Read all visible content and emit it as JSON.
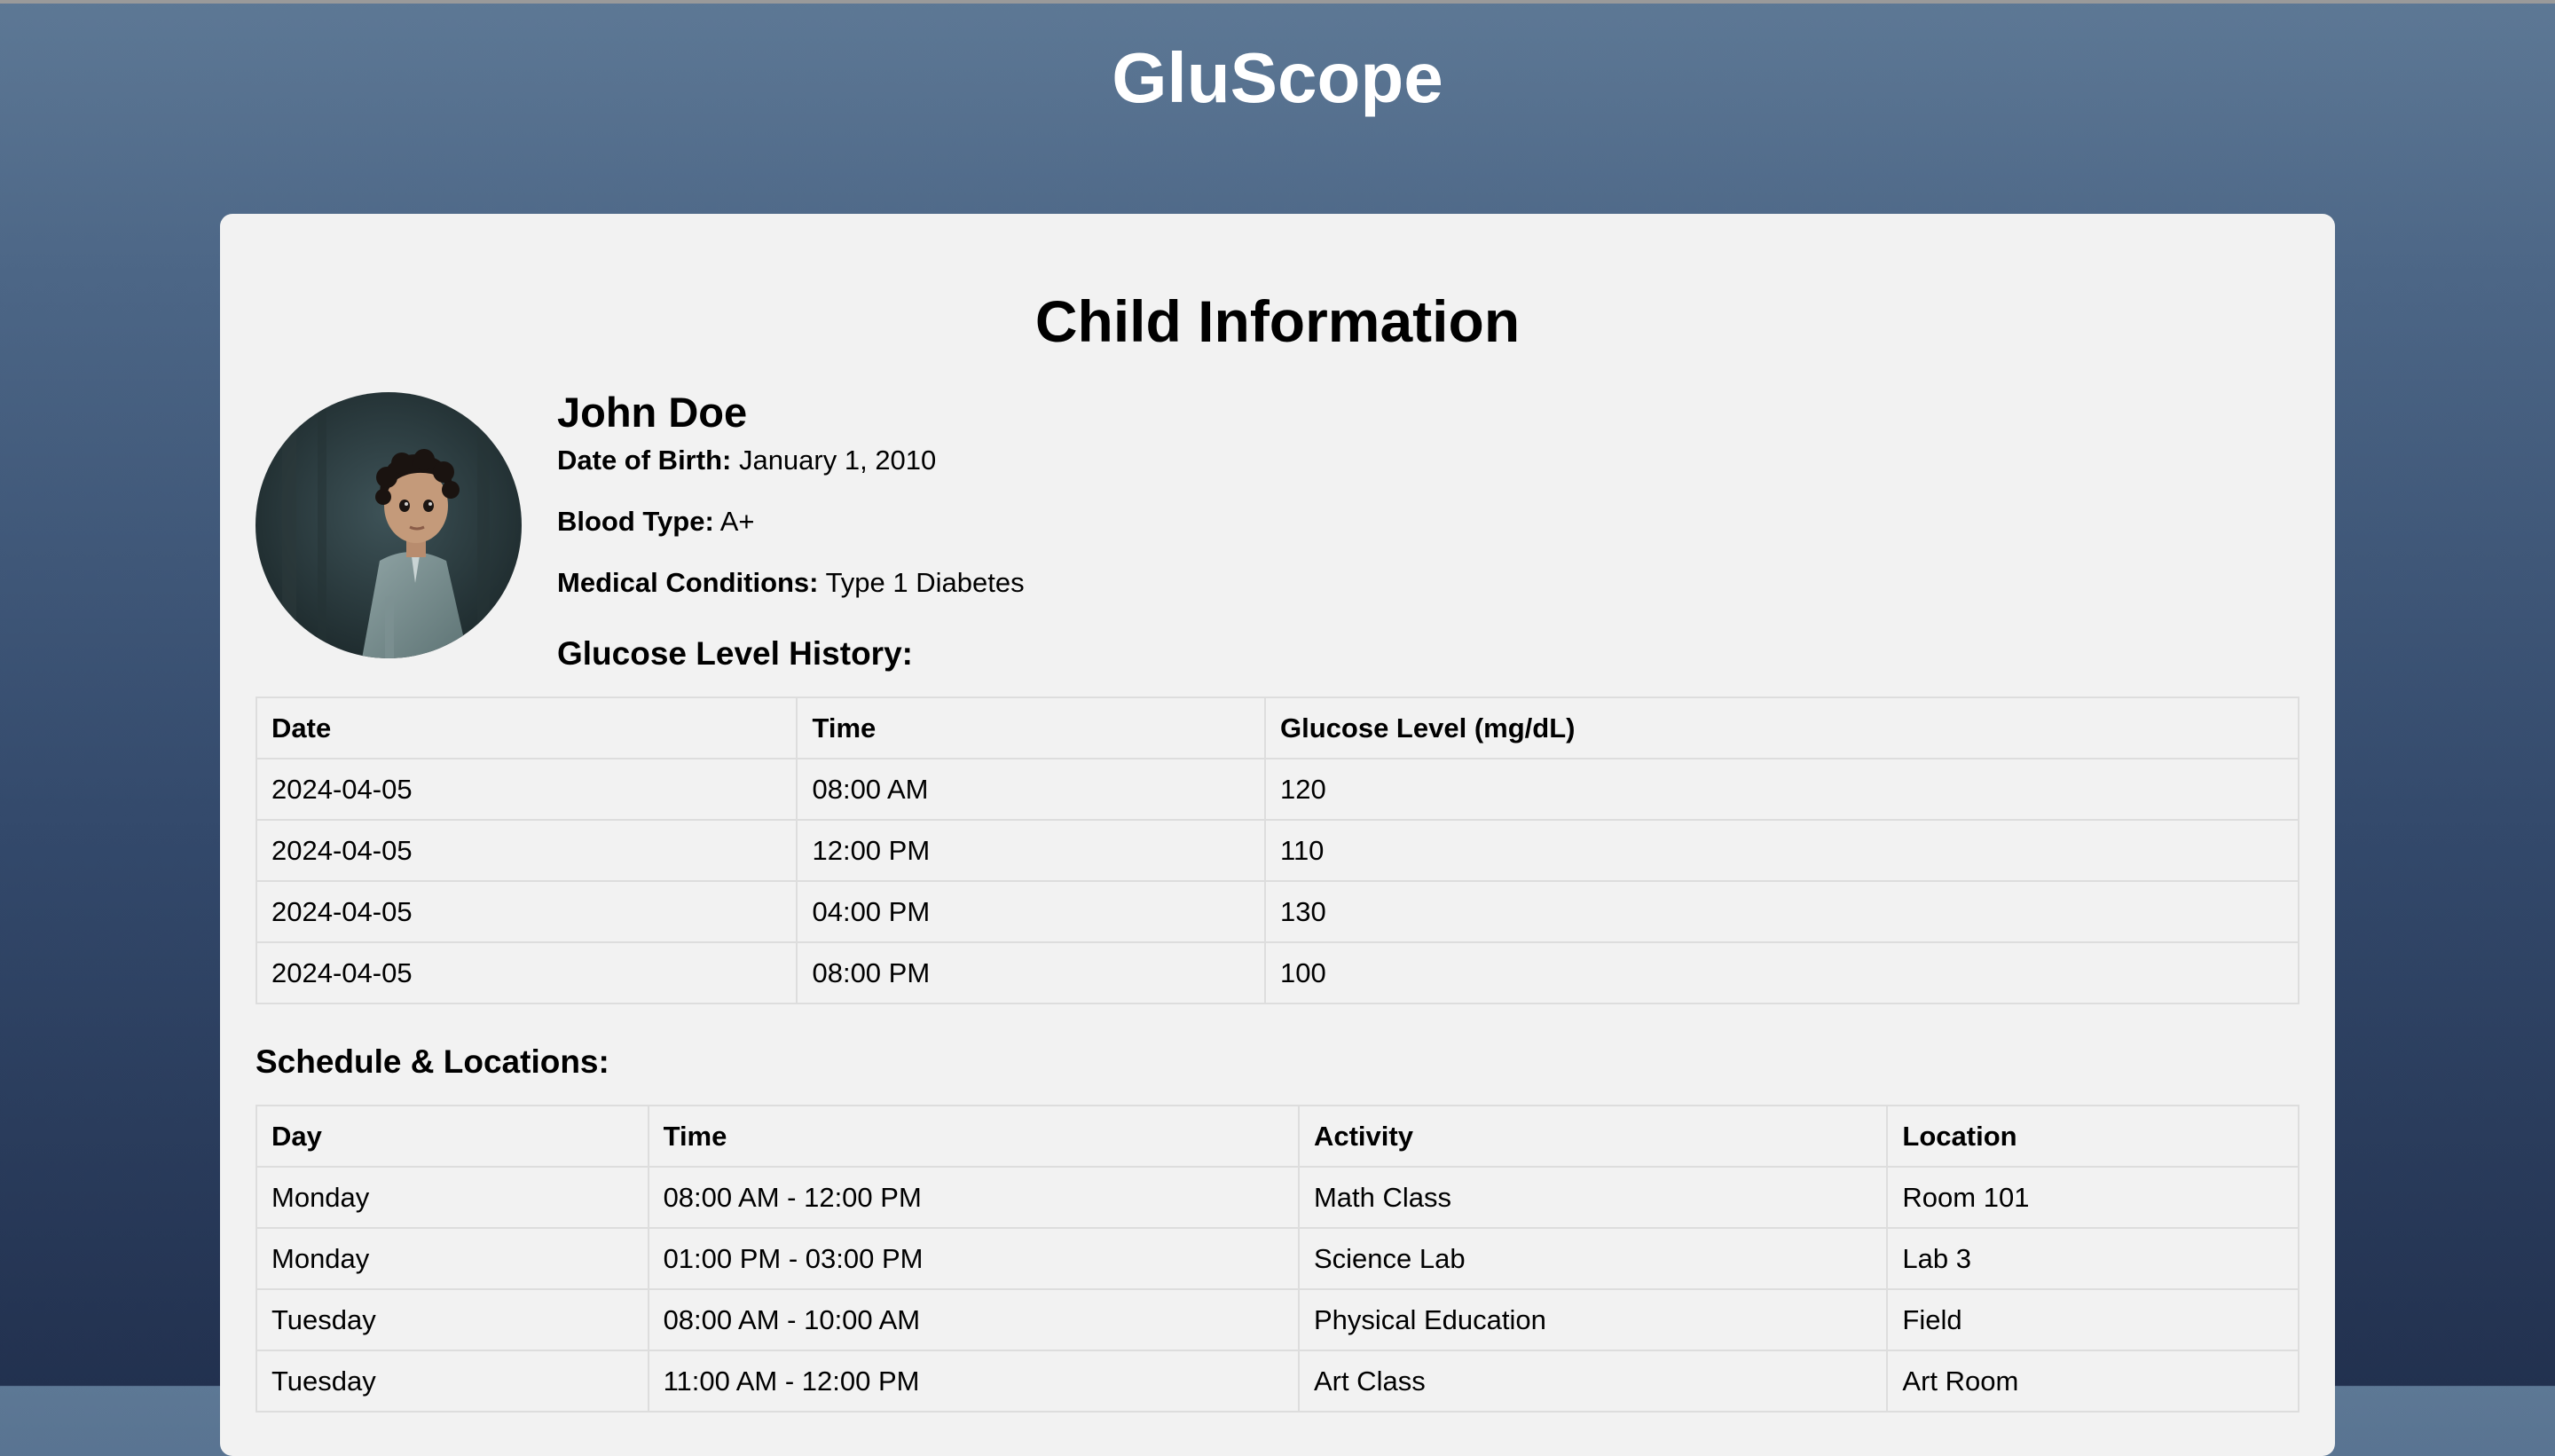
{
  "app": {
    "title": "GluScope"
  },
  "child_section": {
    "title": "Child Information",
    "photo": "child-portrait",
    "name": "John Doe",
    "fields": [
      {
        "label": "Date of Birth:",
        "value": "January 1, 2010"
      },
      {
        "label": "Blood Type:",
        "value": "A+"
      },
      {
        "label": "Medical Conditions:",
        "value": "Type 1 Diabetes"
      }
    ]
  },
  "glucose": {
    "heading": "Glucose Level History:",
    "columns": [
      "Date",
      "Time",
      "Glucose Level (mg/dL)"
    ],
    "rows": [
      [
        "2024-04-05",
        "08:00 AM",
        "120"
      ],
      [
        "2024-04-05",
        "12:00 PM",
        "110"
      ],
      [
        "2024-04-05",
        "04:00 PM",
        "130"
      ],
      [
        "2024-04-05",
        "08:00 PM",
        "100"
      ]
    ]
  },
  "schedule": {
    "heading": "Schedule & Locations:",
    "columns": [
      "Day",
      "Time",
      "Activity",
      "Location"
    ],
    "rows": [
      [
        "Monday",
        "08:00 AM - 12:00 PM",
        "Math Class",
        "Room 101"
      ],
      [
        "Monday",
        "01:00 PM - 03:00 PM",
        "Science Lab",
        "Lab 3"
      ],
      [
        "Tuesday",
        "08:00 AM - 10:00 AM",
        "Physical Education",
        "Field"
      ],
      [
        "Tuesday",
        "11:00 AM - 12:00 PM",
        "Art Class",
        "Art Room"
      ]
    ]
  },
  "colors": {
    "header_gradient_top": "#5d7895",
    "header_gradient_bottom": "#22314f",
    "card_background": "#f2f2f2",
    "table_border": "#dddddd"
  }
}
